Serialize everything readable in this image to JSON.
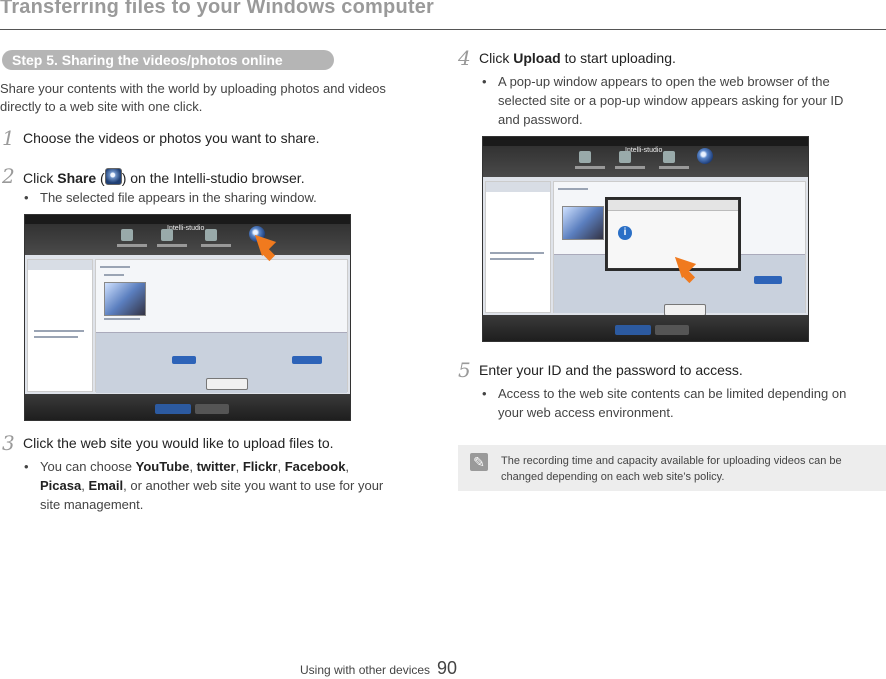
{
  "header": {
    "title": "Transferring files to your Windows computer"
  },
  "section": {
    "pill": "Step 5. Sharing the videos/photos online"
  },
  "intro": "Share your contents with the world by uploading photos and videos directly to a web site with one click.",
  "steps": [
    {
      "num": "1",
      "text": "Choose the videos or photos you want to share."
    },
    {
      "num": "2",
      "pre": "Click ",
      "bold": "Share",
      "post_open": " (",
      "post_close": ") on the Intelli-studio browser.",
      "bullet": "The selected file appears in the sharing window."
    },
    {
      "num": "3",
      "text": "Click the web site you would like to upload files to.",
      "bullet_pre": "You can choose ",
      "sites": [
        "YouTube",
        "twitter",
        "Flickr",
        "Facebook",
        "Picasa",
        "Email"
      ],
      "sep": ", ",
      "bullet_post": ", or another web site you want to use for your",
      "bullet_line2": "site management."
    },
    {
      "num": "4",
      "pre": "Click ",
      "bold": "Upload",
      "post": " to start uploading.",
      "bullet_l1": "A pop-up window appears to open the web browser of the",
      "bullet_l2": "selected site or a pop-up window appears asking for your ID",
      "bullet_l3": "and password."
    },
    {
      "num": "5",
      "text": "Enter your ID and the password to access.",
      "bullet_l1": "Access to the web site contents can be limited depending on",
      "bullet_l2": "your web access environment."
    }
  ],
  "note": {
    "icon": "pencil-note-icon",
    "line1": "The recording time and capacity available for uploading videos can be",
    "line2": "changed depending on each web site’s policy."
  },
  "footer": {
    "label": "Using with other devices",
    "page": "90"
  },
  "colors": {
    "accent_arrow": "#f07a1e",
    "pill_bg": "#b5b5b5",
    "note_bg": "#ededed"
  }
}
